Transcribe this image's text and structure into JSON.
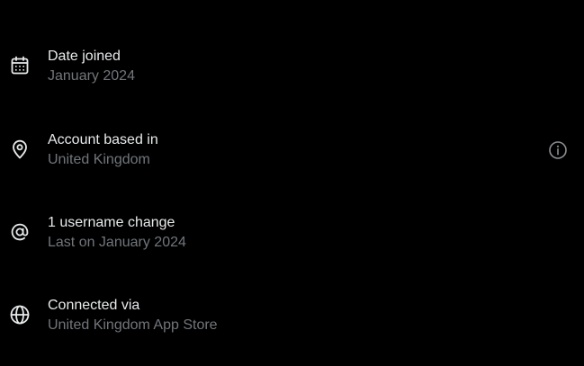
{
  "rows": [
    {
      "icon": "calendar-icon",
      "title": "Date joined",
      "subtitle": "January 2024"
    },
    {
      "icon": "location-pin-icon",
      "title": "Account based in",
      "subtitle": "United Kingdom",
      "trailing_icon": "info-icon"
    },
    {
      "icon": "at-sign-icon",
      "title": "1 username change",
      "subtitle": "Last on January 2024"
    },
    {
      "icon": "globe-icon",
      "title": "Connected via",
      "subtitle": "United Kingdom App Store"
    }
  ],
  "colors": {
    "background": "#000000",
    "primary_text": "#e7e9ea",
    "secondary_text": "#71767b",
    "info_icon": "#8b8f94"
  }
}
